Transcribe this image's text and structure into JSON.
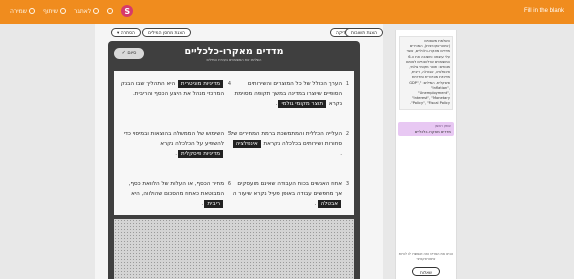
{
  "topbar": {
    "logo": "S",
    "items": [
      {
        "label": "שמירה",
        "icon": "heart-icon"
      },
      {
        "label": "שיתוף",
        "icon": "share-icon"
      },
      {
        "label": "לאתגר",
        "icon": "flag-icon"
      },
      {
        "label": "",
        "icon": "clock-icon"
      }
    ],
    "title": "Fill in the blank"
  },
  "toolbar": {
    "show_answers": "הצגת תשובות",
    "check": "בדיקה",
    "open_word_bank": "הצגת מחסן המילים",
    "hide": "הסתרה ▾"
  },
  "card": {
    "title": "מדדים מאקרו-כלכליים",
    "subtitle": "השלימו את המשפטים בעזרת המילים",
    "done_label": "סיום ✓"
  },
  "items": [
    {
      "num": "1",
      "before": "הערך הכולל של כל המוצרים והשירותים הסופיים שיוצרו במדינה במשך תקופה מסוימת נקרא",
      "answer": "תוצר מקומי גולמי",
      "after": "."
    },
    {
      "num": "2",
      "before": "העלייה הכללית והמתמשכת ברמת המחירים של סחורות ושירותים בכלכלה נקראת",
      "answer": "אינפלציה",
      "after": "."
    },
    {
      "num": "3",
      "before": "אחוז האנשים בכוח העבודה שאינם מועסקים אך מחפשים עבודה באופן פעיל נקרא שיעור ה",
      "answer": "אבטלה",
      "after": "."
    },
    {
      "num": "4",
      "before": "",
      "answer": "מדיניות מוניטרית",
      "after": "היא התהליך שבו הבנק המרכזי מנהל את היצע הכסף והריבית."
    },
    {
      "num": "5",
      "before": "השימוש של הממשלה בהוצאות ובמיסוי כדי להשפיע על הכלכלה נקרא",
      "answer": "מדיניות פיסקלית",
      "after": "."
    },
    {
      "num": "6",
      "before": "מחיר הכסף, או העלות של הלוואת כסף, המבוטאת כאחוז מהסכום שהולווה, היא",
      "answer": "ריבית",
      "after": "."
    }
  ],
  "side": {
    "description": "השלמת משפטים (אינטראקטיבית), המכירים מדדים מאקרו-כלכליים, אשר עלי עוצמה וחשובה את ה-6 המשפטים שרלוונטיים לאותם מונחים: תוצר מקומי גולמי, אינפלציה, אבטלה, ריבית, מדיניות מוניטרית ומדיניות פיסקלית. המילים: \"GDP\", \"Inflation\", \"Unemployment\", \"Interest\", \"Monetary Policy\", \"Fiscal Policy\".",
    "card_label": "עותק ראשון",
    "card_title": "מדדים מאקרו-כלכליים",
    "footer": "הכינו את הפריט הזה ואפשרו לו להיות אינטראקטיבי",
    "button": "שאלות"
  }
}
